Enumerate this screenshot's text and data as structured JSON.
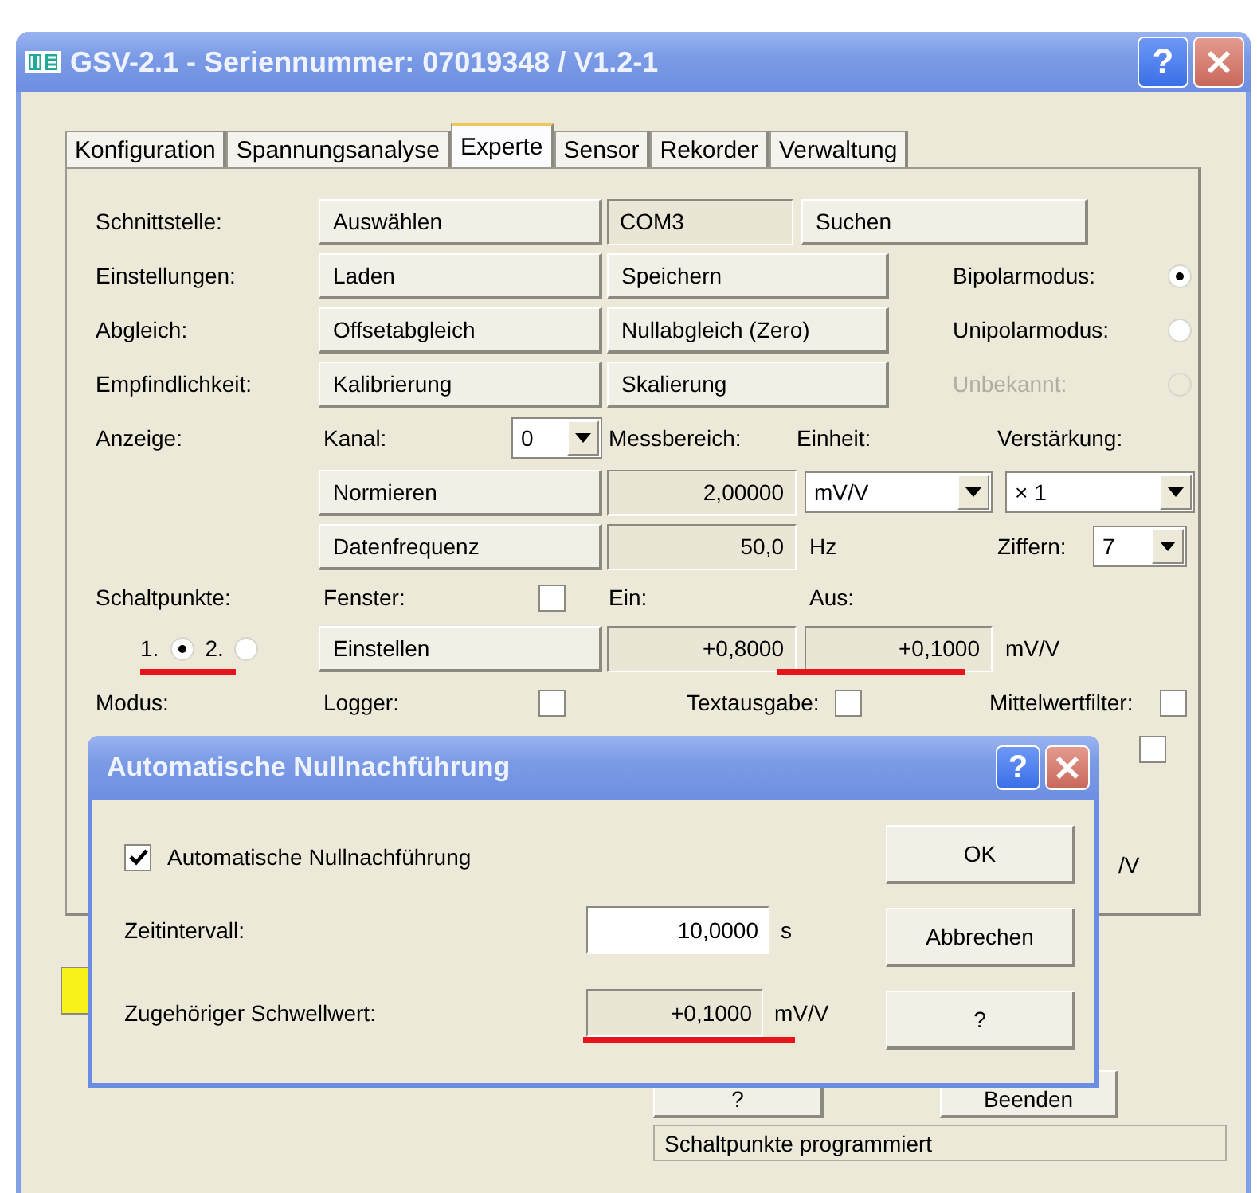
{
  "window": {
    "title": "GSV-2.1 - Seriennummer: 07019348 / V1.2-1",
    "help": "?"
  },
  "tabs": [
    {
      "label": "Konfiguration",
      "selected": false
    },
    {
      "label": "Spannungsanalyse",
      "selected": false
    },
    {
      "label": "Experte",
      "selected": true
    },
    {
      "label": "Sensor",
      "selected": false
    },
    {
      "label": "Rekorder",
      "selected": false
    },
    {
      "label": "Verwaltung",
      "selected": false
    }
  ],
  "interface": {
    "label": "Schnittstelle:",
    "select_button": "Auswählen",
    "port": "COM3",
    "search_button": "Suchen"
  },
  "setting_rows": [
    {
      "label": "Einstellungen:",
      "buttons": [
        "Laden",
        "Speichern"
      ],
      "mode_label": "Bipolarmodus:",
      "selected": true,
      "disabled": false
    },
    {
      "label": "Abgleich:",
      "buttons": [
        "Offsetabgleich",
        "Nullabgleich (Zero)"
      ],
      "mode_label": "Unipolarmodus:",
      "selected": false,
      "disabled": false
    },
    {
      "label": "Empfindlichkeit:",
      "buttons": [
        "Kalibrierung",
        "Skalierung"
      ],
      "mode_label": "Unbekannt:",
      "selected": false,
      "disabled": true
    }
  ],
  "display": {
    "label": "Anzeige:",
    "channel_label": "Kanal:",
    "channel_value": "0",
    "range_label": "Messbereich:",
    "unit_label": "Einheit:",
    "gain_label": "Verstärkung:",
    "normalize_button": "Normieren",
    "range_value": "2,00000",
    "unit_value": "mV/V",
    "gain_value": "× 1",
    "rate_button": "Datenfrequenz",
    "rate_value": "50,0",
    "rate_unit": "Hz",
    "digits_label": "Ziffern:",
    "digits_value": "7"
  },
  "switchpoints": {
    "label": "Schaltpunkte:",
    "window_label": "Fenster:",
    "window_checked": false,
    "on_label": "Ein:",
    "off_label": "Aus:",
    "points": [
      {
        "label": "1.",
        "selected": true
      },
      {
        "label": "2.",
        "selected": false
      }
    ],
    "set_button": "Einstellen",
    "on_value": "+0,8000",
    "off_value": "+0,1000",
    "unit": "mV/V"
  },
  "mode_row": {
    "label": "Modus:",
    "options": [
      {
        "label": "Logger:",
        "checked": false
      },
      {
        "label": "Textausgabe:",
        "checked": false
      },
      {
        "label": "Mittelwertfilter:",
        "checked": false
      }
    ]
  },
  "hidden_row": {
    "checked": false
  },
  "partial_unit": "/V",
  "footer_buttons": [
    "?",
    "Beenden"
  ],
  "status_text": "Schaltpunkte programmiert",
  "dialog": {
    "title": "Automatische Nullnachführung",
    "help": "?",
    "auto_zero": {
      "label": "Automatische Nullnachführung",
      "checked": true
    },
    "interval": {
      "label": "Zeitintervall:",
      "value": "10,0000",
      "unit": "s"
    },
    "threshold": {
      "label": "Zugehöriger Schwellwert:",
      "value": "+0,1000",
      "unit": "mV/V"
    },
    "buttons": [
      "OK",
      "Abbrechen",
      "?"
    ]
  }
}
